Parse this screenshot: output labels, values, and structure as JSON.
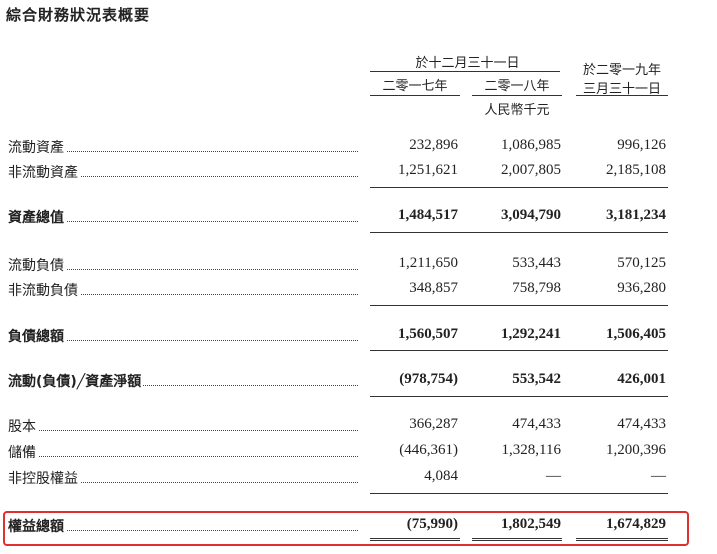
{
  "title": "綜合財務狀況表概要",
  "header": {
    "group_label": "於十二月三十一日",
    "col_2017": "二零一七年",
    "col_2018": "二零一八年",
    "col_2019_line1": "於二零一九年",
    "col_2019_line2": "三月三十一日",
    "unit": "人民幣千元"
  },
  "rows": [
    {
      "label": "流動資產",
      "v2017": "232,896",
      "v2018": "1,086,985",
      "v2019": "996,126"
    },
    {
      "label": "非流動資產",
      "v2017": "1,251,621",
      "v2018": "2,007,805",
      "v2019": "2,185,108"
    },
    {
      "label": "資產總值",
      "v2017": "1,484,517",
      "v2018": "3,094,790",
      "v2019": "3,181,234"
    },
    {
      "label": "流動負債",
      "v2017": "1,211,650",
      "v2018": "533,443",
      "v2019": "570,125"
    },
    {
      "label": "非流動負債",
      "v2017": "348,857",
      "v2018": "758,798",
      "v2019": "936,280"
    },
    {
      "label": "負債總額",
      "v2017": "1,560,507",
      "v2018": "1,292,241",
      "v2019": "1,506,405"
    },
    {
      "label": "流動(負債)╱資產淨額",
      "v2017": "(978,754)",
      "v2018": "553,542",
      "v2019": "426,001"
    },
    {
      "label": "股本",
      "v2017": "366,287",
      "v2018": "474,433",
      "v2019": "474,433"
    },
    {
      "label": "儲備",
      "v2017": "(446,361)",
      "v2018": "1,328,116",
      "v2019": "1,200,396"
    },
    {
      "label": "非控股權益",
      "v2017": "4,084",
      "v2018": "—",
      "v2019": "—"
    },
    {
      "label": "權益總額",
      "v2017": "(75,990)",
      "v2018": "1,802,549",
      "v2019": "1,674,829"
    }
  ]
}
